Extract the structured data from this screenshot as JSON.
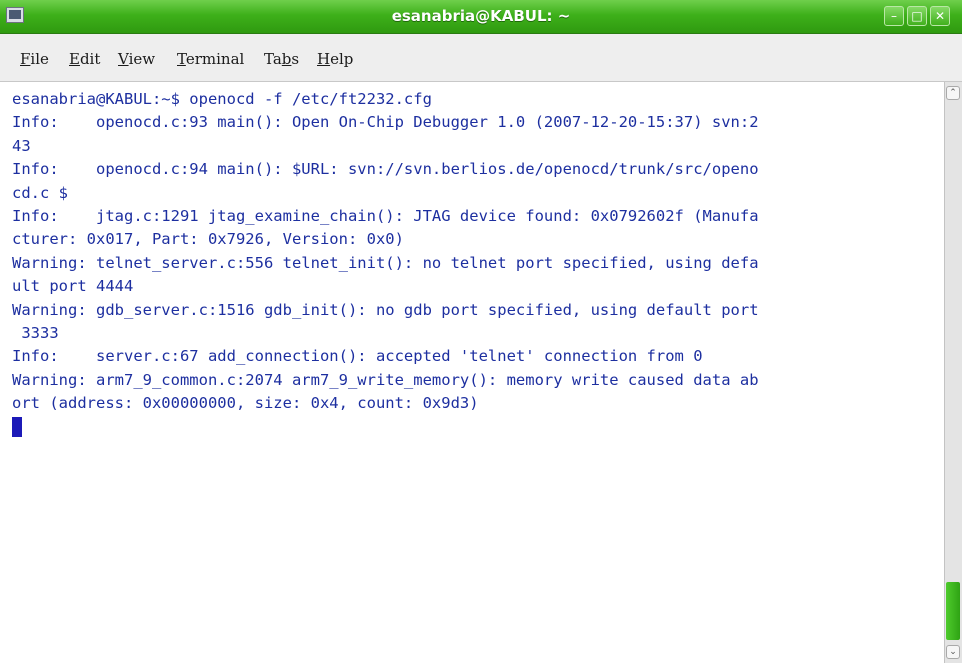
{
  "window": {
    "title": "esanabria@KABUL: ~",
    "icon": "terminal-app-icon",
    "controls": {
      "minimize_glyph": "–",
      "maximize_glyph": "□",
      "close_glyph": "✕"
    },
    "accent_color": "#3eb01a"
  },
  "menubar": {
    "items": [
      {
        "pre": "",
        "u": "F",
        "post": "ile"
      },
      {
        "pre": "",
        "u": "E",
        "post": "dit"
      },
      {
        "pre": "",
        "u": "V",
        "post": "iew"
      },
      {
        "pre": "",
        "u": "T",
        "post": "erminal"
      },
      {
        "pre": "Ta",
        "u": "b",
        "post": "s"
      },
      {
        "pre": "",
        "u": "H",
        "post": "elp"
      }
    ]
  },
  "terminal": {
    "text_color": "#1d2fa0",
    "lines": [
      "esanabria@KABUL:~$ openocd -f /etc/ft2232.cfg",
      "Info:    openocd.c:93 main(): Open On-Chip Debugger 1.0 (2007-12-20-15:37) svn:2",
      "43",
      "Info:    openocd.c:94 main(): $URL: svn://svn.berlios.de/openocd/trunk/src/openo",
      "cd.c $",
      "Info:    jtag.c:1291 jtag_examine_chain(): JTAG device found: 0x0792602f (Manufa",
      "cturer: 0x017, Part: 0x7926, Version: 0x0)",
      "Warning: telnet_server.c:556 telnet_init(): no telnet port specified, using defa",
      "ult port 4444",
      "Warning: gdb_server.c:1516 gdb_init(): no gdb port specified, using default port",
      " 3333",
      "Info:    server.c:67 add_connection(): accepted 'telnet' connection from 0",
      "Warning: arm7_9_common.c:2074 arm7_9_write_memory(): memory write caused data ab",
      "ort (address: 0x00000000, size: 0x4, count: 0x9d3)"
    ]
  },
  "scrollbar": {
    "up_glyph": "⌃",
    "down_glyph": "⌄",
    "position": 0.96
  }
}
